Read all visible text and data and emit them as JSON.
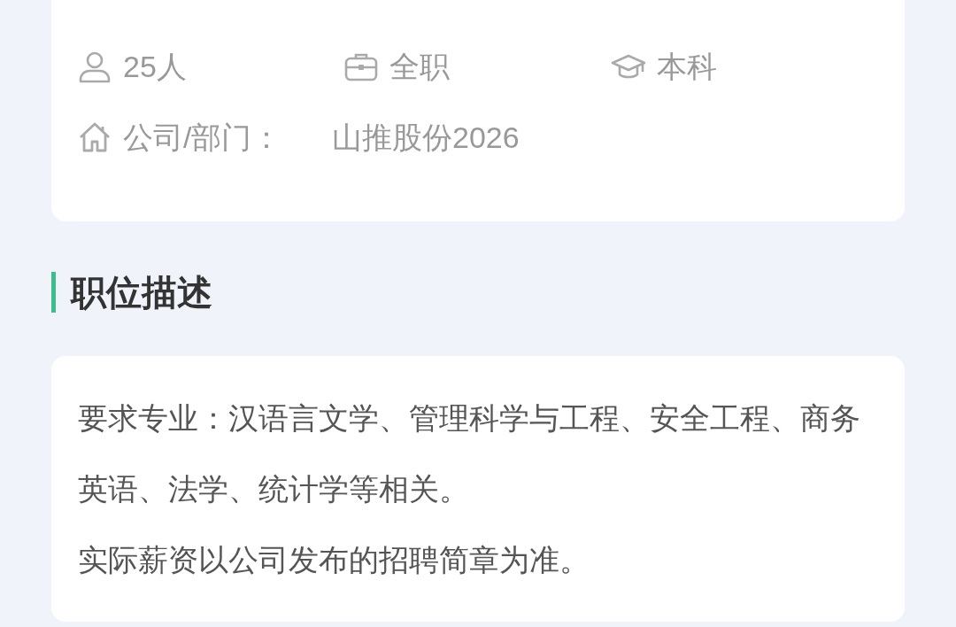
{
  "job_info": {
    "headcount": "25人",
    "job_type": "全职",
    "education": "本科",
    "company_label": "公司/部门：",
    "company": "山推股份2026"
  },
  "section": {
    "title": "职位描述"
  },
  "description": [
    "要求专业：汉语言文学、管理科学与工程、安全工程、商务英语、法学、统计学等相关。",
    "实际薪资以公司发布的招聘简章为准。"
  ]
}
